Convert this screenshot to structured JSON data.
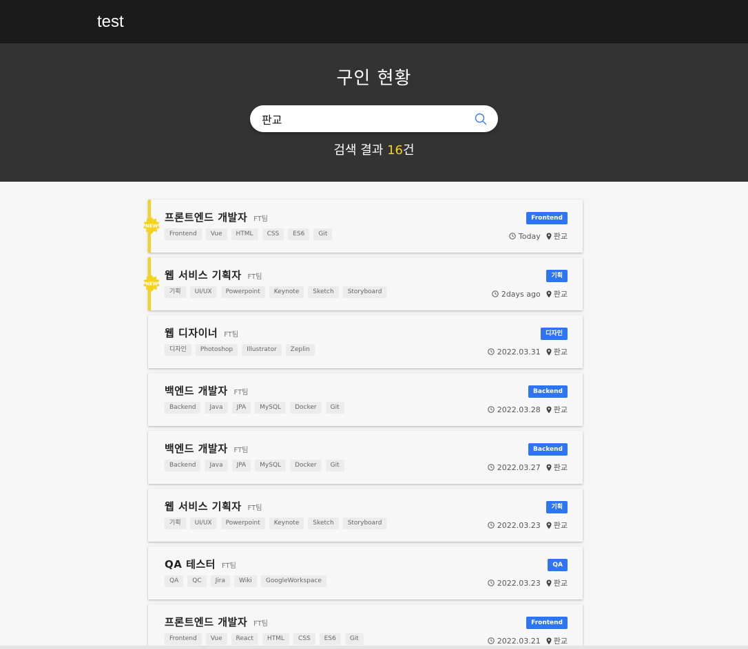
{
  "header": {
    "brand": "test"
  },
  "hero": {
    "title": "구인 현황",
    "search_value": "판교",
    "result_prefix": "검색 결과 ",
    "result_count": "16",
    "result_suffix": "건"
  },
  "colors": {
    "accent_yellow": "#f5d21b",
    "category_blue": "#2f74f0",
    "topbar": "#1b1b1b",
    "hero": "#333333"
  },
  "jobs": [
    {
      "title": "프론트엔드 개발자",
      "team": "FT팀",
      "tags": [
        "Frontend",
        "Vue",
        "HTML",
        "CSS",
        "ES6",
        "Git"
      ],
      "category": "Frontend",
      "date": "Today",
      "location": "판교",
      "is_new": true
    },
    {
      "title": "웹 서비스 기획자",
      "team": "FT팀",
      "tags": [
        "기획",
        "UI/UX",
        "Powerpoint",
        "Keynote",
        "Sketch",
        "Storyboard"
      ],
      "category": "기획",
      "date": "2days ago",
      "location": "판교",
      "is_new": true
    },
    {
      "title": "웹 디자이너",
      "team": "FT팀",
      "tags": [
        "디자인",
        "Photoshop",
        "Illustrator",
        "Zeplin"
      ],
      "category": "디자인",
      "date": "2022.03.31",
      "location": "판교",
      "is_new": false
    },
    {
      "title": "백엔드 개발자",
      "team": "FT팀",
      "tags": [
        "Backend",
        "Java",
        "JPA",
        "MySQL",
        "Docker",
        "Git"
      ],
      "category": "Backend",
      "date": "2022.03.28",
      "location": "판교",
      "is_new": false
    },
    {
      "title": "백엔드 개발자",
      "team": "FT팀",
      "tags": [
        "Backend",
        "Java",
        "JPA",
        "MySQL",
        "Docker",
        "Git"
      ],
      "category": "Backend",
      "date": "2022.03.27",
      "location": "판교",
      "is_new": false
    },
    {
      "title": "웹 서비스 기획자",
      "team": "FT팀",
      "tags": [
        "기획",
        "UI/UX",
        "Powerpoint",
        "Keynote",
        "Sketch",
        "Storyboard"
      ],
      "category": "기획",
      "date": "2022.03.23",
      "location": "판교",
      "is_new": false
    },
    {
      "title": "QA 테스터",
      "team": "FT팀",
      "tags": [
        "QA",
        "QC",
        "Jira",
        "Wiki",
        "GoogleWorkspace"
      ],
      "category": "QA",
      "date": "2022.03.23",
      "location": "판교",
      "is_new": false
    },
    {
      "title": "프론트엔드 개발자",
      "team": "FT팀",
      "tags": [
        "Frontend",
        "Vue",
        "React",
        "HTML",
        "CSS",
        "ES6",
        "Git"
      ],
      "category": "Frontend",
      "date": "2022.03.21",
      "location": "판교",
      "is_new": false
    }
  ],
  "icons": {
    "search": "search-icon",
    "clock": "clock-icon",
    "location": "location-pin-icon",
    "new": "new-badge-icon"
  }
}
